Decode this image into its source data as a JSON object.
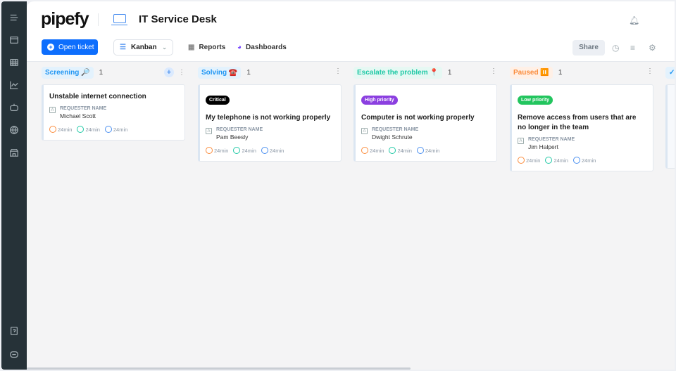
{
  "sidebar": {
    "icons": [
      "menu-icon",
      "inbox-icon",
      "table-icon",
      "chart-icon",
      "bot-icon",
      "globe-icon",
      "store-icon",
      "help-icon",
      "chat-icon"
    ]
  },
  "header": {
    "logo": "pipefy",
    "title": "IT Service Desk",
    "open_ticket": "Open ticket",
    "view": "Kanban",
    "reports": "Reports",
    "dashboards": "Dashboards",
    "share": "Share"
  },
  "columns": [
    {
      "name": "Screening 🔎",
      "count": "1",
      "color": "#2196f3",
      "bg": "#e3f2fd",
      "cards": [
        {
          "badge": "",
          "title": "Unstable internet connection",
          "field_label": "REQUESTER NAME",
          "field_value": "Michael Scott",
          "timers": [
            "24min",
            "24min",
            "24min"
          ]
        }
      ]
    },
    {
      "name": "Solving ☎️",
      "count": "1",
      "color": "#2196f3",
      "bg": "#e3f2fd",
      "cards": [
        {
          "badge": "Critical",
          "badge_color": "#000000",
          "title": "My telephone is not working properly",
          "field_label": "REQUESTER NAME",
          "field_value": "Pam Beesly",
          "timers": [
            "24min",
            "24min",
            "24min"
          ]
        }
      ]
    },
    {
      "name": "Escalate the problem 📍",
      "count": "1",
      "color": "#20c9a6",
      "bg": "#e6f8f3",
      "cards": [
        {
          "badge": "High priority",
          "badge_color": "#8b3fe0",
          "title": "Computer is not working properly",
          "field_label": "REQUESTER NAME",
          "field_value": "Dwight Schrute",
          "timers": [
            "24min",
            "24min",
            "24min"
          ]
        }
      ]
    },
    {
      "name": "Paused ⏸️",
      "count": "1",
      "color": "#fb8c3c",
      "bg": "#fff0e6",
      "cards": [
        {
          "badge": "Low priority",
          "badge_color": "#22c55e",
          "title": "Remove access from users that are no longer in the team",
          "field_label": "REQUESTER NAME",
          "field_value": "Jim Halpert",
          "timers": [
            "24min",
            "24min",
            "24min"
          ]
        }
      ]
    }
  ]
}
